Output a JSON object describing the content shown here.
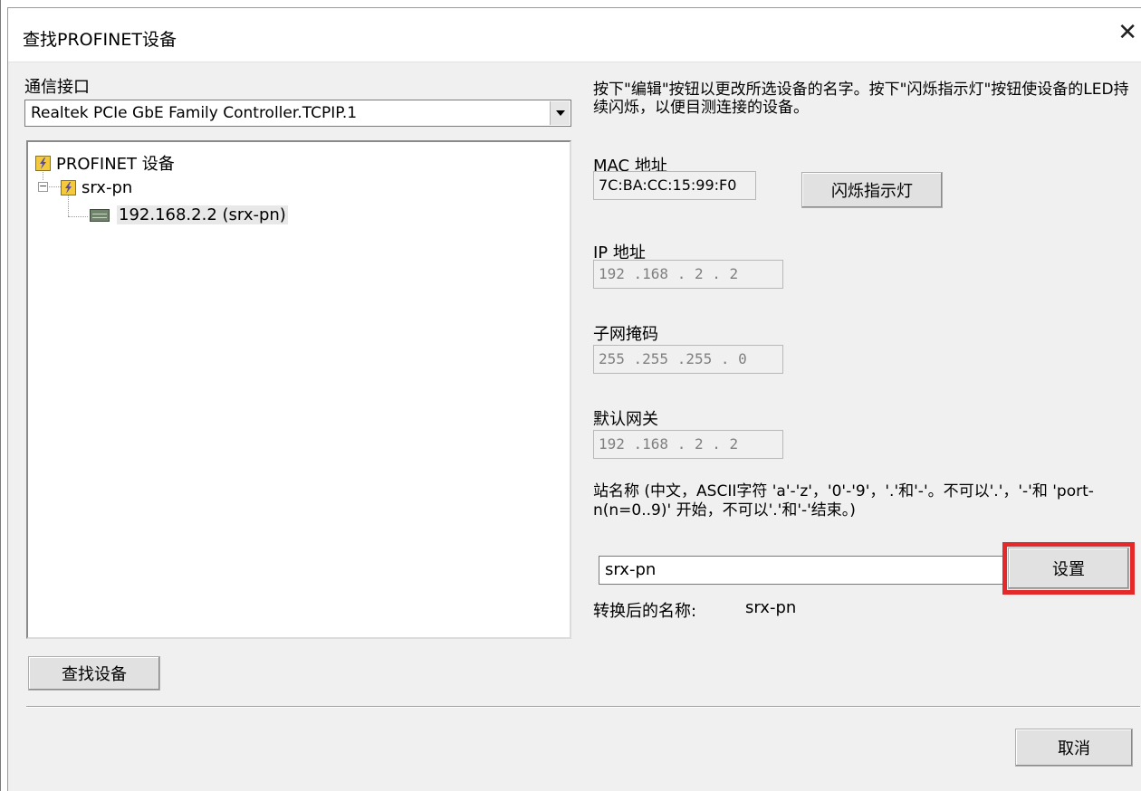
{
  "dialog": {
    "title": "查找PROFINET设备",
    "close_symbol": "✕"
  },
  "left": {
    "interface_label": "通信接口",
    "interface_value": "Realtek PCIe GbE Family Controller.TCPIP.1",
    "tree": {
      "root": "PROFINET 设备",
      "node": "srx-pn",
      "leaf": "192.168.2.2 (srx-pn)"
    },
    "find_button": "查找设备"
  },
  "right": {
    "instructions": "按下\"编辑\"按钮以更改所选设备的名字。按下\"闪烁指示灯\"按钮使设备的LED持续闪烁，以便目测连接的设备。",
    "mac_label": "MAC 地址",
    "mac_value": "7C:BA:CC:15:99:F0",
    "blink_button": "闪烁指示灯",
    "ip_label": "IP 地址",
    "ip_value": "192 .168 . 2 . 2",
    "subnet_label": "子网掩码",
    "subnet_value": "255 .255 .255 . 0",
    "gateway_label": "默认网关",
    "gateway_value": "192 .168 . 2 . 2",
    "station_hint": "站名称 (中文，ASCII字符 'a'-'z'，'0'-'9'，'.'和'-'。不可以'.'，'-'和 'port-n(n=0..9)' 开始，不可以'.'和'-'结束。)",
    "station_value": "srx-pn",
    "set_button": "设置",
    "converted_label": "转换后的名称:",
    "converted_value": "srx-pn"
  },
  "footer": {
    "cancel_button": "取消"
  },
  "colors": {
    "highlight": "#e32929",
    "dialog_bg": "#f0f0f0"
  },
  "icons": [
    "close-icon",
    "dropdown-arrow-icon",
    "profinet-icon",
    "device-icon",
    "tree-collapse-icon"
  ]
}
